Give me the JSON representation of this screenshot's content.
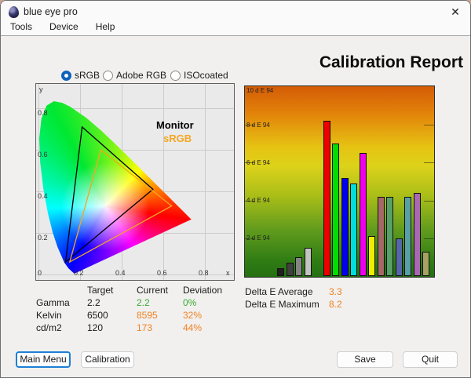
{
  "window": {
    "title": "blue eye pro",
    "close_glyph": "✕"
  },
  "menu": {
    "items": [
      {
        "label": "Tools"
      },
      {
        "label": "Device"
      },
      {
        "label": "Help"
      }
    ]
  },
  "profiles": {
    "options": [
      {
        "label": "sRGB",
        "selected": true
      },
      {
        "label": "Adobe RGB",
        "selected": false
      },
      {
        "label": "ISOcoated",
        "selected": false
      }
    ]
  },
  "report": {
    "title": "Calibration Report"
  },
  "colors": {
    "good": "#3aab36",
    "warn": "#ef8222",
    "monitor": "#000000",
    "srgb": "#f5a623"
  },
  "chart_data": [
    {
      "id": "cie-chromaticity",
      "type": "area",
      "title": "CIE 1931 chromaticity diagram",
      "xlabel": "x",
      "ylabel": "y",
      "xlim": [
        0,
        0.9
      ],
      "ylim": [
        0,
        0.92
      ],
      "xticks": [
        "0",
        "0.2",
        "0.4",
        "0.6",
        "0.8"
      ],
      "yticks": [
        "0.2",
        "0.4",
        "0.6",
        "0.8"
      ],
      "grid": true,
      "legend": [
        {
          "name": "Monitor",
          "color": "#000000"
        },
        {
          "name": "sRGB",
          "color": "#f5a623"
        }
      ],
      "series": [
        {
          "name": "Monitor",
          "color": "#000000",
          "vertices": [
            [
              0.21,
              0.71
            ],
            [
              0.55,
              0.41
            ],
            [
              0.13,
              0.06
            ]
          ]
        },
        {
          "name": "sRGB",
          "color": "#f5a623",
          "vertices": [
            [
              0.3,
              0.6
            ],
            [
              0.64,
              0.33
            ],
            [
              0.15,
              0.06
            ]
          ]
        }
      ]
    },
    {
      "id": "delta-e-bars",
      "type": "bar",
      "title": "Delta E 94 per patch",
      "ylim": [
        0,
        10
      ],
      "yticks": [
        {
          "value": 10,
          "label": "10 d E 94"
        },
        {
          "value": 8,
          "label": "8 d E 94"
        },
        {
          "value": 6,
          "label": "6 d E 94"
        },
        {
          "value": 4,
          "label": "4 d E 94"
        },
        {
          "value": 2,
          "label": "2 d E 94"
        }
      ],
      "bars": [
        {
          "color": "#1f1f1f",
          "value": 0.4
        },
        {
          "color": "#404040",
          "value": 0.7
        },
        {
          "color": "#848484",
          "value": 1.0
        },
        {
          "color": "#c4c4c4",
          "value": 1.5
        },
        {
          "color": "#ee0000",
          "value": 8.2
        },
        {
          "color": "#00dd00",
          "value": 7.0
        },
        {
          "color": "#0000ee",
          "value": 5.2
        },
        {
          "color": "#00dddd",
          "value": 4.9
        },
        {
          "color": "#ee00ee",
          "value": 6.5
        },
        {
          "color": "#eeee00",
          "value": 2.1
        },
        {
          "color": "#a56767",
          "value": 4.2
        },
        {
          "color": "#57a068",
          "value": 4.2
        },
        {
          "color": "#5766ab",
          "value": 2.0
        },
        {
          "color": "#57a0a8",
          "value": 4.2
        },
        {
          "color": "#a968b2",
          "value": 4.4
        },
        {
          "color": "#a8a164",
          "value": 1.3
        }
      ]
    }
  ],
  "result_table": {
    "headers": {
      "target": "Target",
      "current": "Current",
      "deviation": "Deviation"
    },
    "rows": [
      {
        "name": "Gamma",
        "target": "2.2",
        "current": "2.2",
        "deviation": "0%"
      },
      {
        "name": "Kelvin",
        "target": "6500",
        "current": "8595",
        "deviation": "32%"
      },
      {
        "name": "cd/m2",
        "target": "120",
        "current": "173",
        "deviation": "44%"
      }
    ]
  },
  "delta_e": {
    "rows": [
      {
        "label": "Delta E Average",
        "value": "3.3"
      },
      {
        "label": "Delta E Maximum",
        "value": "8.2"
      }
    ]
  },
  "buttons": {
    "main_menu": "Main Menu",
    "calibration": "Calibration",
    "save": "Save",
    "quit": "Quit"
  }
}
